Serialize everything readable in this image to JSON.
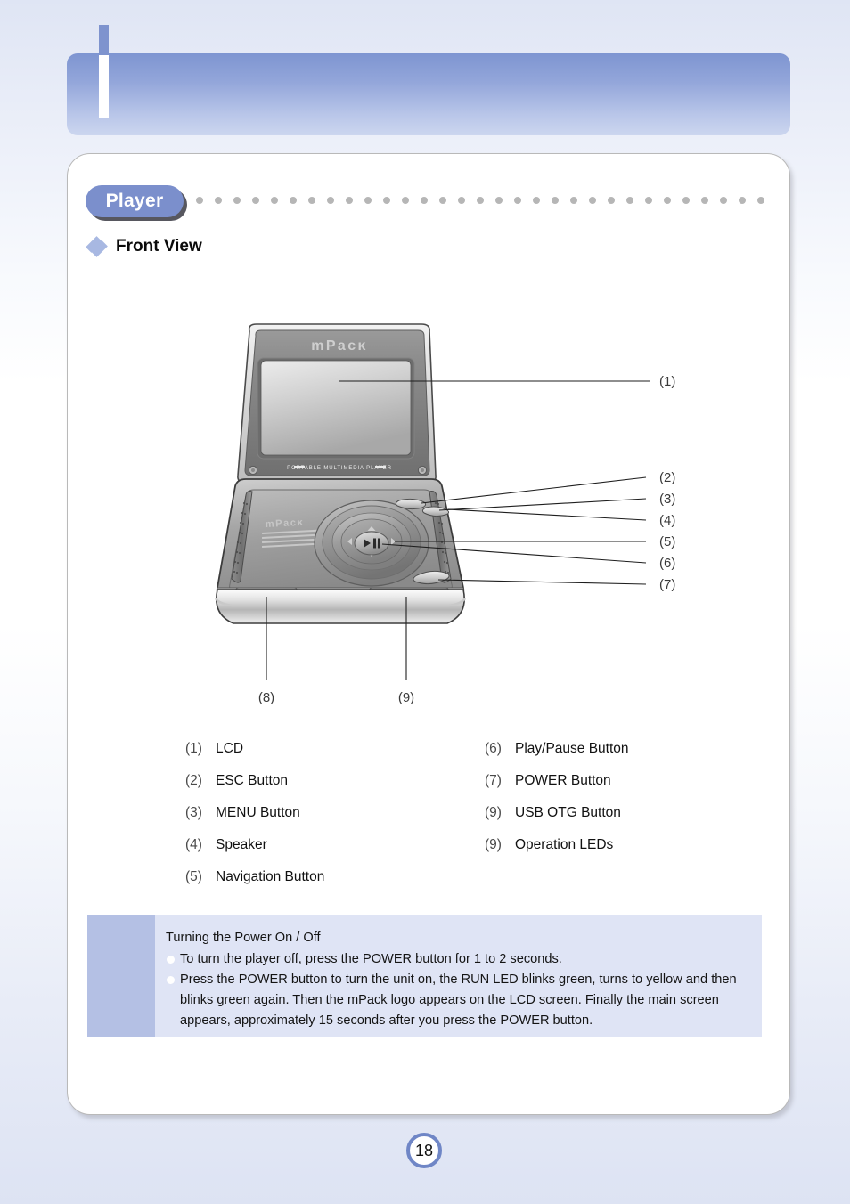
{
  "page": {
    "number": "18"
  },
  "section": {
    "tab_label": "Player",
    "subheading": "Front View"
  },
  "diagram": {
    "device_name": "mPack",
    "lid_logo": "mPack",
    "lid_tagline": "PORTABLE MULTIMEDIA PLAYER",
    "base_logo": "mPack",
    "usb_port_label": "USB",
    "led_labels": [
      "USB",
      "RUN",
      "CHG"
    ],
    "center_button_glyph": "play-pause",
    "callouts_right": [
      "(1)",
      "(2)",
      "(3)",
      "(4)",
      "(5)",
      "(6)",
      "(7)"
    ],
    "callouts_bottom": [
      "(8)",
      "(9)"
    ]
  },
  "legend": {
    "left_column": [
      {
        "num": "(1)",
        "label": "LCD"
      },
      {
        "num": "(2)",
        "label": "ESC Button"
      },
      {
        "num": "(3)",
        "label": "MENU Button"
      },
      {
        "num": "(4)",
        "label": "Speaker"
      },
      {
        "num": "(5)",
        "label": "Navigation Button"
      }
    ],
    "right_column": [
      {
        "num": "(6)",
        "label": "Play/Pause Button"
      },
      {
        "num": "(7)",
        "label": "POWER Button"
      },
      {
        "num": "(9)",
        "label": "USB OTG Button"
      },
      {
        "num": "(9)",
        "label": "Operation LEDs"
      }
    ]
  },
  "note": {
    "title": "Turning the Power On / Off",
    "items": [
      "To turn the player off, press the POWER button for 1 to 2 seconds.",
      "Press the POWER button to turn the unit on, the RUN LED blinks green, turns to yellow and then blinks green again. Then the mPack logo appears on the LCD screen. Finally the main screen appears, approximately 15 seconds after you press the POWER button."
    ]
  },
  "colors": {
    "accent_blue": "#7b8fcc",
    "header_blue": "#8ba0d6",
    "note_bg": "#dfe4f5",
    "note_accent": "#b4c0e4",
    "dot_gray": "#b6b6b6"
  }
}
